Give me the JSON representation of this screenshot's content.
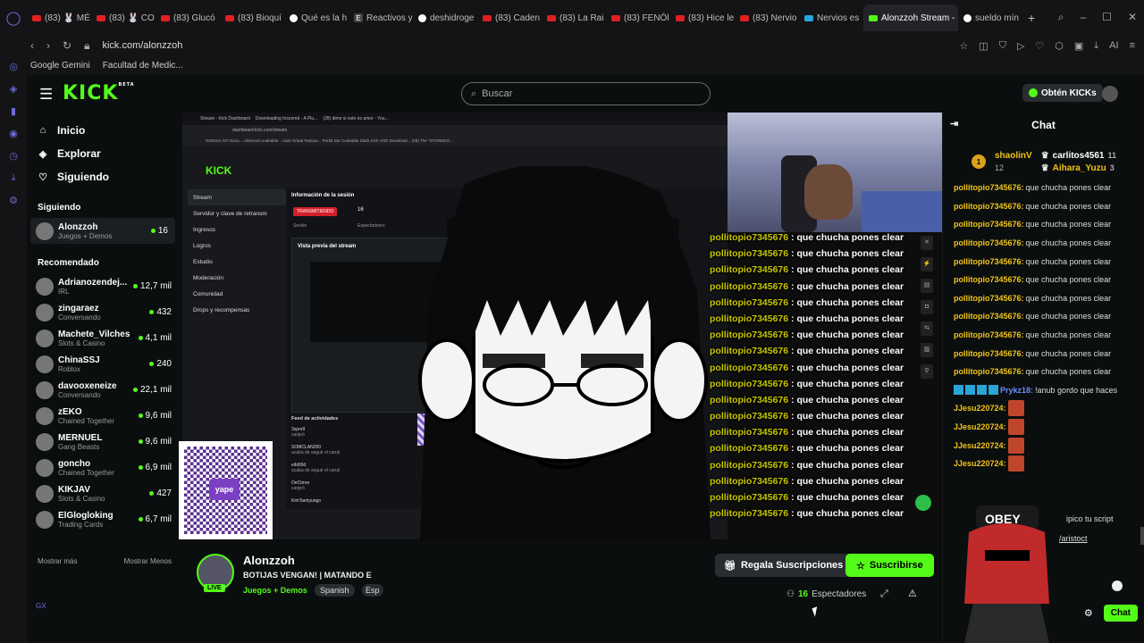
{
  "browser": {
    "tabs": [
      {
        "label": "(83) 🐰 MÉ",
        "fav": "yt"
      },
      {
        "label": "(83) 🐰 CO",
        "fav": "yt"
      },
      {
        "label": "(83) Glucó",
        "fav": "yt"
      },
      {
        "label": "(83) Bioquí",
        "fav": "yt"
      },
      {
        "label": "Qué es la h",
        "fav": "g"
      },
      {
        "label": "Reactivos y",
        "fav": "e"
      },
      {
        "label": "deshidroge",
        "fav": "g"
      },
      {
        "label": "(83) Caden",
        "fav": "yt"
      },
      {
        "label": "(83) La Rai",
        "fav": "yt"
      },
      {
        "label": "(83) FENÓl",
        "fav": "yt"
      },
      {
        "label": "(83) Hice le",
        "fav": "yt"
      },
      {
        "label": "(83) Nervio",
        "fav": "yt"
      },
      {
        "label": "Nervios es",
        "fav": "k"
      },
      {
        "label": "Alonzzoh Stream - ∨",
        "fav": "kick",
        "active": true
      },
      {
        "label": "sueldo mín",
        "fav": "g"
      }
    ],
    "url": "kick.com/alonzzoh",
    "bookmarks": [
      "Google Gemini",
      "Facultad de Medic..."
    ]
  },
  "header": {
    "logo": "KICK",
    "logo_sup": "BETA",
    "search_placeholder": "Buscar",
    "kicks_button": "Obtén KICKs"
  },
  "sidebar": {
    "nav": [
      {
        "label": "Inicio",
        "icon": "home-icon"
      },
      {
        "label": "Explorar",
        "icon": "compass-icon"
      },
      {
        "label": "Siguiendo",
        "icon": "heart-icon"
      }
    ],
    "following_title": "Siguiendo",
    "following": [
      {
        "name": "Alonzzoh",
        "category": "Juegos + Demos",
        "viewers": "16"
      }
    ],
    "recommended_title": "Recomendado",
    "recommended": [
      {
        "name": "Adrianozendej...",
        "category": "IRL",
        "viewers": "12,7 mil"
      },
      {
        "name": "zingaraez",
        "category": "Conversando",
        "viewers": "432"
      },
      {
        "name": "Machete_Vilches",
        "category": "Slots & Casino",
        "viewers": "4,1 mil"
      },
      {
        "name": "ChinaSSJ",
        "category": "Roblox",
        "viewers": "240"
      },
      {
        "name": "davooxeneize",
        "category": "Conversando",
        "viewers": "22,1 mil"
      },
      {
        "name": "zEKO",
        "category": "Chained Together",
        "viewers": "9,6 mil"
      },
      {
        "name": "MERNUEL",
        "category": "Gang Beasts",
        "viewers": "9,6 mil"
      },
      {
        "name": "goncho",
        "category": "Chained Together",
        "viewers": "6,9 mil"
      },
      {
        "name": "KIKJAV",
        "category": "Slots & Casino",
        "viewers": "427"
      },
      {
        "name": "ElGlogloking",
        "category": "Trading Cards",
        "viewers": "6,7 mil"
      }
    ],
    "show_more": "Mostrar más",
    "show_less": "Mostrar Menos"
  },
  "video": {
    "inner": {
      "tabs": [
        "Stream - Kick Dashboard",
        "Downloading Inscered - A Plu...",
        "(28) dime si esto es amor - You..."
      ],
      "url": "dashboard.kick.com/stream",
      "bookmarks": "OmDocs API Docu...   cliexroom.codeable...   Aula Virtual Toulous...   Portal Dar   Codeable   Slack   Kick VOD Download...   (28) The \"STORMCO...",
      "logo": "KICK",
      "menu": [
        "Stream",
        "Servidor y clave de retransm",
        "Ingresos",
        "Logros",
        "Estudio",
        "Moderación",
        "Comunidad",
        "Drops y recompensas"
      ],
      "session_title": "Información de la sesión",
      "transmitting": "TRANSMITIENDO",
      "session_count": "16",
      "session_label": "Sesión",
      "viewers_label": "Espectadores",
      "preview_title": "Vista previa del stream",
      "chat_title": "Chat",
      "feed_title": "Feed de actividades",
      "feed": [
        {
          "user": "3xpre9",
          "action": "canjeó"
        },
        {
          "user": "SOMCLAN200",
          "action": "acaba de seguir el canal"
        },
        {
          "user": "eibl00d",
          "action": "acaba de seguir el canal"
        },
        {
          "user": "OeCtmre",
          "action": "canjeó"
        },
        {
          "user": "KimTaehyungo",
          "action": ""
        }
      ]
    },
    "overlay_user": "pollitopio7345676",
    "overlay_sep": " : ",
    "overlay_msg": "que chucha pones clear",
    "overlay_count": 18
  },
  "stream": {
    "name": "Alonzzoh",
    "title": "BOTIJAS VENGAN! | MATANDO E",
    "category": "Juegos + Demos",
    "tag1": "Spanish",
    "tag2": "Esp",
    "live": "LIVE",
    "gift_button": "Regala Suscripciones",
    "sub_button": "Suscribirse",
    "viewers_count": "16",
    "viewers_label": "Espectadores"
  },
  "chat": {
    "title": "Chat",
    "pinned": {
      "rank": "1",
      "user1": "shaolinV",
      "count1": "12",
      "user2": "carlitos4561",
      "count2": "11",
      "user3": "Aihara_Yuzu",
      "count3": "3"
    },
    "messages": [
      {
        "user": "pollitopio7345676:",
        "text": "que chucha pones clear"
      },
      {
        "user": "pollitopio7345676:",
        "text": "que chucha pones clear"
      },
      {
        "user": "pollitopio7345676:",
        "text": "que chucha pones clear"
      },
      {
        "user": "pollitopio7345676:",
        "text": "que chucha pones clear"
      },
      {
        "user": "pollitopio7345676:",
        "text": "que chucha pones clear"
      },
      {
        "user": "pollitopio7345676:",
        "text": "que chucha pones clear"
      },
      {
        "user": "pollitopio7345676:",
        "text": "que chucha pones clear"
      },
      {
        "user": "pollitopio7345676:",
        "text": "que chucha pones clear"
      },
      {
        "user": "pollitopio7345676:",
        "text": "que chucha pones clear"
      },
      {
        "user": "pollitopio7345676:",
        "text": "que chucha pones clear"
      },
      {
        "user": "pollitopio7345676:",
        "text": "que chucha pones clear"
      },
      {
        "user": "Prykz18:",
        "text": "!anub gordo que haces"
      },
      {
        "user": "JJesu220724:",
        "text": ""
      },
      {
        "user": "JJesu220724:",
        "text": ""
      },
      {
        "user": "JJesu220724:",
        "text": ""
      },
      {
        "user": "JJesu220724:",
        "text": ""
      }
    ],
    "partial_text": "ipico tu script",
    "partial_link": "/aristoct",
    "send_button": "Chat"
  }
}
